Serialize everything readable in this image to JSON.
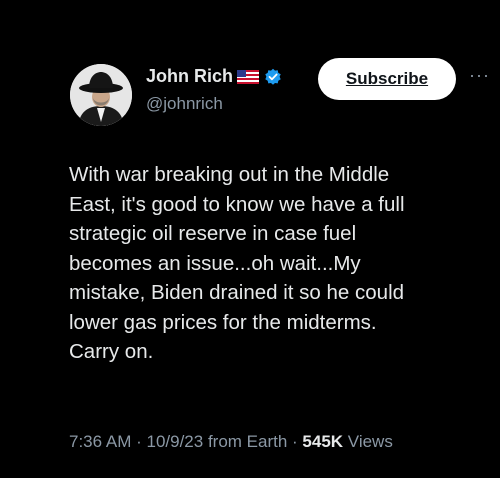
{
  "author": {
    "display_name": "John Rich",
    "handle": "@johnrich",
    "flag_icon": "us-flag-icon",
    "verified_icon": "verified-badge-icon",
    "verified_color": "#1d9bf0"
  },
  "actions": {
    "subscribe_label": "Subscribe",
    "more_label": "···"
  },
  "tweet": {
    "text": "With war breaking out in the Middle\nEast, it's good to know we have a full\nstrategic oil reserve in case fuel\nbecomes an issue...oh wait...My\nmistake, Biden drained it so he could\nlower gas prices for the midterms.\nCarry on."
  },
  "meta": {
    "time": "7:36 AM",
    "sep1": " · ",
    "date": "10/9/23",
    "source": " from Earth",
    "sep2": " · ",
    "views_count": "545K",
    "views_label": " Views"
  },
  "colors": {
    "background": "#000000",
    "text_primary": "#e7e9ea",
    "text_secondary": "#8b98a5",
    "button_bg": "#ffffff"
  }
}
